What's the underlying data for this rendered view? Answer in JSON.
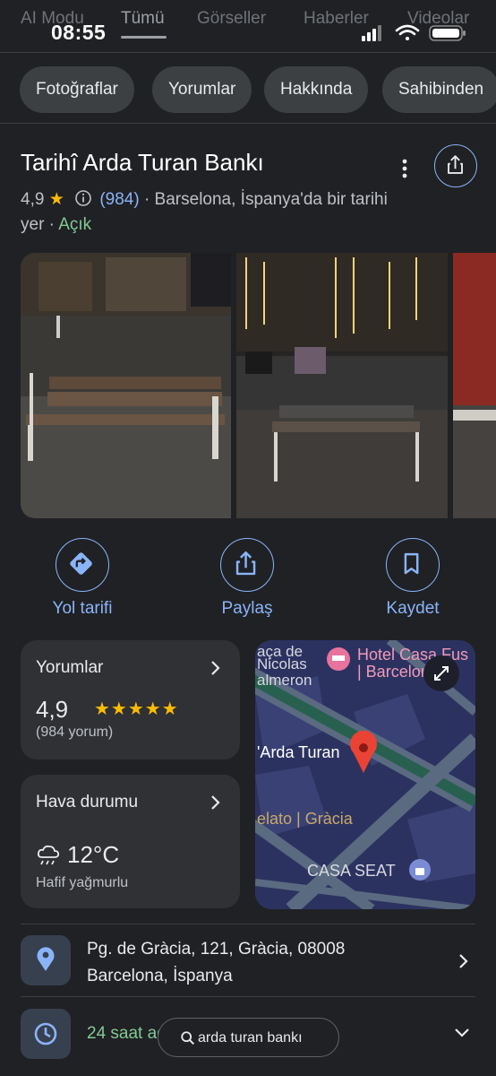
{
  "status_bar": {
    "time": "08:55"
  },
  "search_tabs": [
    "AI Modu",
    "Tümü",
    "Görseller",
    "Haberler",
    "Videolar"
  ],
  "chips": [
    "Fotoğraflar",
    "Yorumlar",
    "Hakkında",
    "Sahibinden"
  ],
  "place": {
    "title": "Tarihî Arda Turan Bankı",
    "rating": "4,9",
    "review_count": "(984)",
    "category_line1": "· Barselona, İspanya'da bir tarihi",
    "category_line2": "yer ·",
    "open_status": "Açık"
  },
  "actions": [
    {
      "label": "Yol tarifi",
      "icon": "directions-icon"
    },
    {
      "label": "Paylaş",
      "icon": "share-icon"
    },
    {
      "label": "Kaydet",
      "icon": "bookmark-icon"
    }
  ],
  "reviews_card": {
    "title": "Yorumlar",
    "rating": "4,9",
    "stars": "★★★★★",
    "count": "(984 yorum)"
  },
  "weather_card": {
    "title": "Hava durumu",
    "temp": "12°C",
    "desc": "Hafif yağmurlu"
  },
  "map": {
    "labels": [
      "aça de",
      "Nicolas",
      "almeron",
      "Hotel Casa Fus",
      "| Barcelon",
      "'Arda Turan",
      "elato | Gràcia",
      "CASA SEAT"
    ]
  },
  "address": {
    "line1": "Pg. de Gràcia, 121, Gràcia, 08008",
    "line2": "Barcelona, İspanya"
  },
  "hours": {
    "text": "24 saat açık"
  },
  "search_pill": {
    "query": "arda turan bankı"
  },
  "colors": {
    "background": "#202124",
    "accent_blue": "#8ab4f8",
    "open_green": "#81c995",
    "star_yellow": "#fbbc04"
  }
}
